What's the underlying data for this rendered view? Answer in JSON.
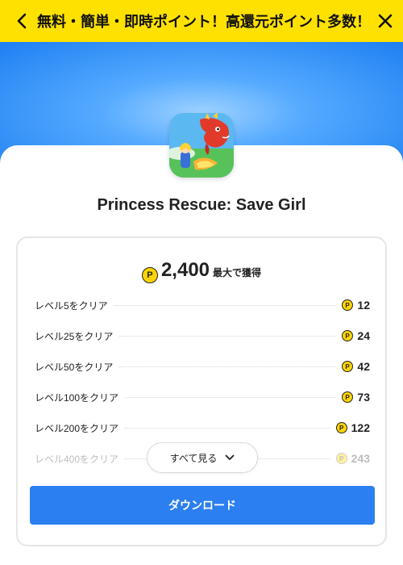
{
  "header": {
    "title": "無料・簡単・即時ポイント！高還元ポイント多数！",
    "back_icon": "chevron-left-icon",
    "close_icon": "close-icon",
    "background": "#ffe100"
  },
  "app": {
    "name": "Princess Rescue: Save Girl",
    "icon": "dragon-princess-app-icon"
  },
  "rewards": {
    "coin_symbol": "P",
    "total": "2,400",
    "total_suffix": "最大で獲得",
    "items": [
      {
        "label": "レベル5をクリア",
        "points": "12"
      },
      {
        "label": "レベル25をクリア",
        "points": "24"
      },
      {
        "label": "レベル50をクリア",
        "points": "42"
      },
      {
        "label": "レベル100をクリア",
        "points": "73"
      },
      {
        "label": "レベル200をクリア",
        "points": "122"
      },
      {
        "label": "レベル400をクリア",
        "points": "243"
      }
    ],
    "see_all_label": "すべて見る"
  },
  "download": {
    "label": "ダウンロード",
    "color": "#2b7ff0"
  }
}
